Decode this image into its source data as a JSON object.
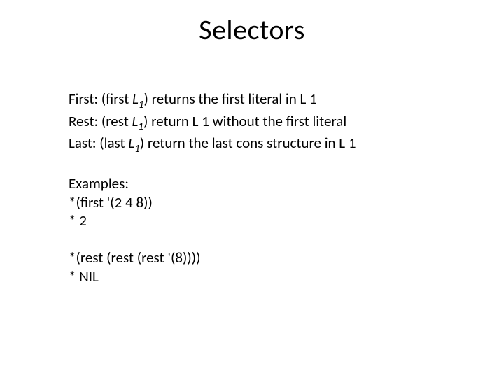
{
  "title": "Selectors",
  "defs": {
    "first_label": "First: (first ",
    "rest_label": "Rest: (rest ",
    "last_label": "Last: (last ",
    "sym": "L",
    "sub": "1",
    "first_tail": ") returns the first literal in L 1",
    "rest_tail": ") return L 1 without the first literal",
    "last_tail": ") return the last cons structure in L 1"
  },
  "examples": {
    "heading": "Examples:",
    "line1": "*(first '(2 4 8))",
    "line2": "* 2",
    "line3": "*(rest (rest (rest '(8))))",
    "line4": "* NIL"
  }
}
